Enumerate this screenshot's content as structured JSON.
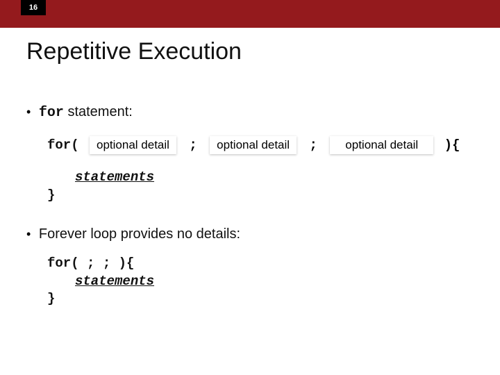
{
  "page_number": "16",
  "title": "Repetitive Execution",
  "bullet1_prefix": "for",
  "bullet1_rest": " statement:",
  "for_kw": "for(",
  "opt_label": "optional detail",
  "semicolon": ";",
  "trail": "){",
  "statements_word": "statements",
  "close_brace": "}",
  "bullet2": "Forever loop provides no details:",
  "forever_line1": "for( ; ; ){",
  "forever_stmt": "statements",
  "forever_close": "}"
}
